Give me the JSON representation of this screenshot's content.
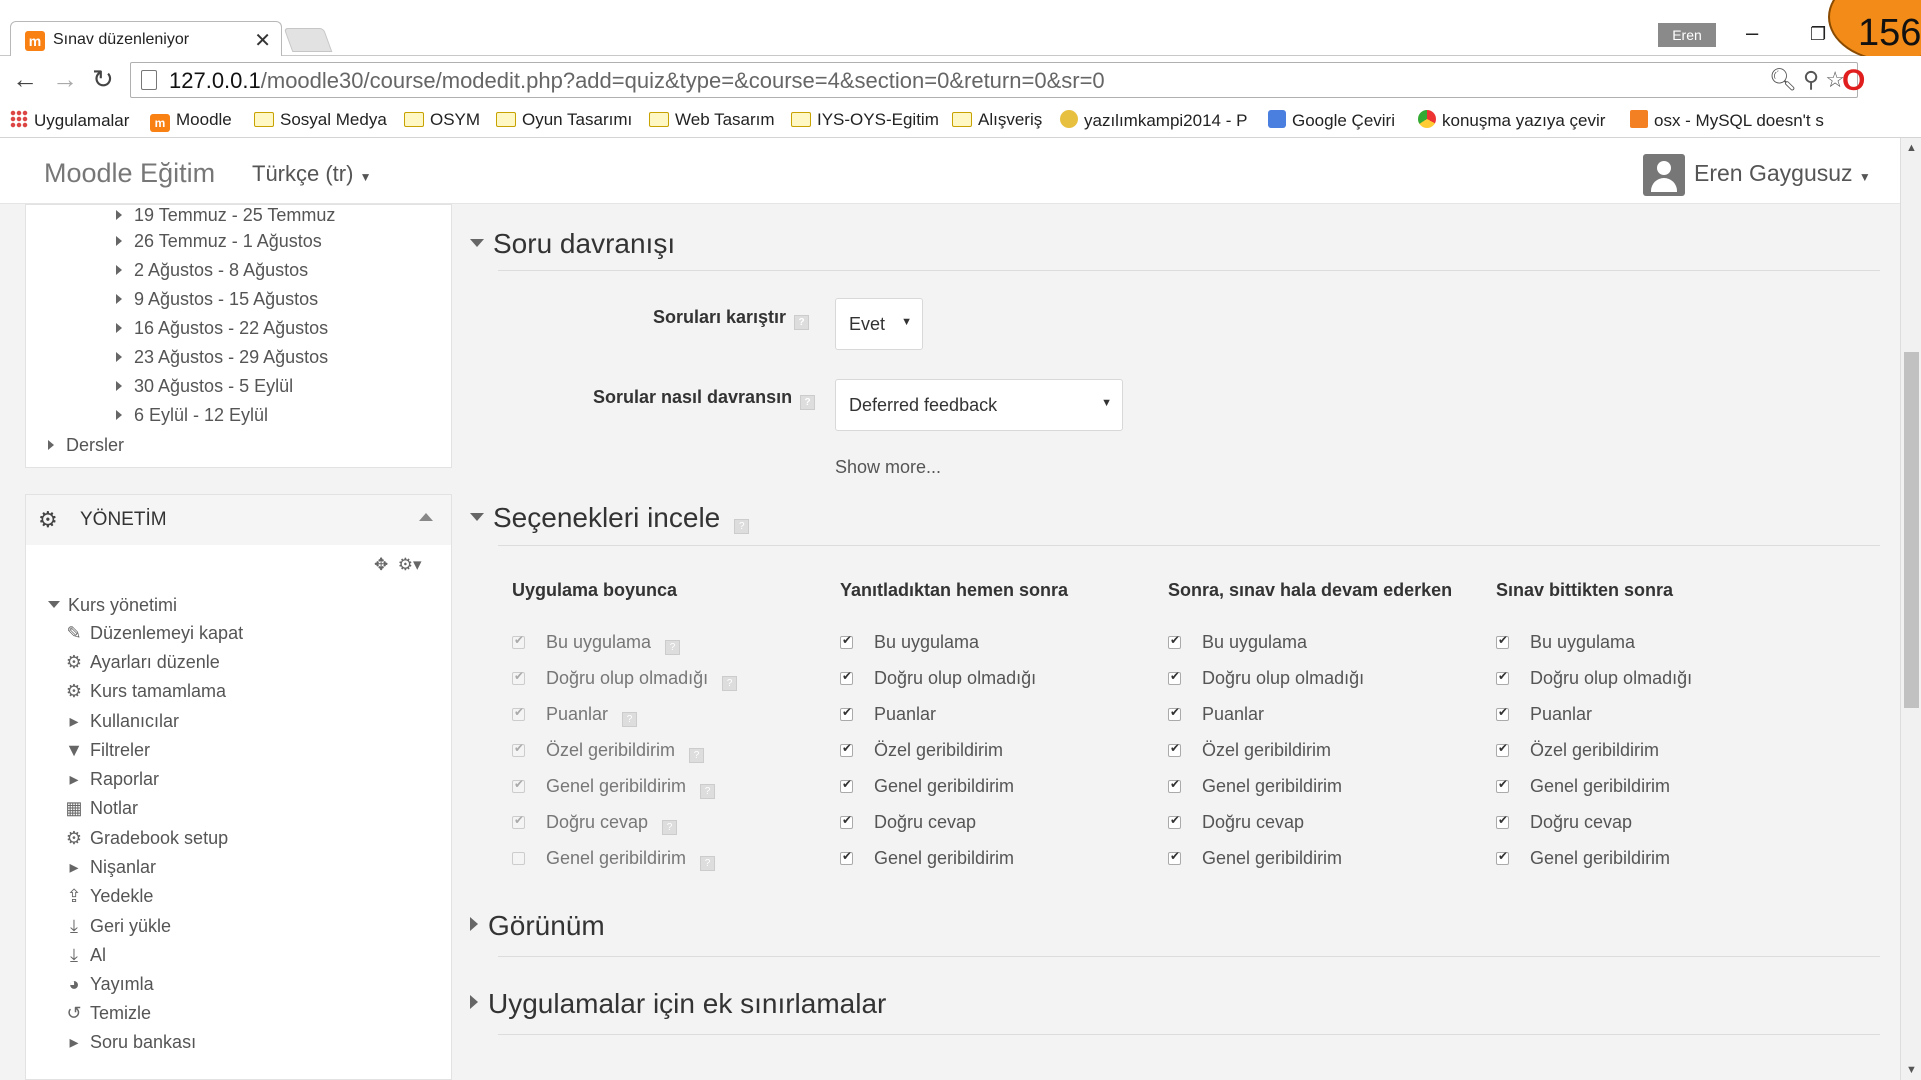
{
  "browser": {
    "tab_title": "Sınav düzenleniyor",
    "tab_close": "✕",
    "user_badge": "Eren",
    "slide_number": "156",
    "url_host": "127.0.0.1",
    "url_path": "/moodle30/course/modedit.php?add=quiz&type=&course=4&section=0&return=0&sr=0",
    "bookmarks": [
      {
        "label": "Uygulamalar",
        "icon": "apps-grid-icon"
      },
      {
        "label": "Moodle",
        "icon": "moodle-icon"
      },
      {
        "label": "Sosyal Medya",
        "icon": "folder-icon"
      },
      {
        "label": "OSYM",
        "icon": "folder-icon"
      },
      {
        "label": "Oyun Tasarımı",
        "icon": "folder-icon"
      },
      {
        "label": "Web Tasarım",
        "icon": "folder-icon"
      },
      {
        "label": "IYS-OYS-Egitim",
        "icon": "folder-icon"
      },
      {
        "label": "Alışveriş",
        "icon": "folder-icon"
      },
      {
        "label": "yazılımkampi2014 - P",
        "icon": "site-icon"
      },
      {
        "label": "Google Çeviri",
        "icon": "translate-icon"
      },
      {
        "label": "konuşma yazıya çevir",
        "icon": "chrome-icon"
      },
      {
        "label": "osx - MySQL doesn't s",
        "icon": "stackoverflow-icon"
      }
    ]
  },
  "moodle": {
    "brand": "Moodle Eğitim",
    "language": "Türkçe (tr)",
    "user_name": "Eren Gaygusuz"
  },
  "navigation": {
    "weeks": [
      "19 Temmuz - 25 Temmuz",
      "26 Temmuz - 1 Ağustos",
      "2 Ağustos - 8 Ağustos",
      "9 Ağustos - 15 Ağustos",
      "16 Ağustos - 22 Ağustos",
      "23 Ağustos - 29 Ağustos",
      "30 Ağustos - 5 Eylül",
      "6 Eylül - 12 Eylül"
    ],
    "courses_label": "Dersler"
  },
  "admin": {
    "title": "YÖNETİM",
    "course_admin": "Kurs yönetimi",
    "items": [
      {
        "label": "Düzenlemeyi kapat",
        "icon": "pencil-icon"
      },
      {
        "label": "Ayarları düzenle",
        "icon": "gear-icon"
      },
      {
        "label": "Kurs tamamlama",
        "icon": "gear-icon"
      },
      {
        "label": "Kullanıcılar",
        "icon": "chevron-right-icon"
      },
      {
        "label": "Filtreler",
        "icon": "filter-icon"
      },
      {
        "label": "Raporlar",
        "icon": "chevron-right-icon"
      },
      {
        "label": "Notlar",
        "icon": "table-icon"
      },
      {
        "label": "Gradebook setup",
        "icon": "gear-icon"
      },
      {
        "label": "Nişanlar",
        "icon": "chevron-right-icon"
      },
      {
        "label": "Yedekle",
        "icon": "upload-icon"
      },
      {
        "label": "Geri yükle",
        "icon": "download-icon"
      },
      {
        "label": "Al",
        "icon": "download-icon"
      },
      {
        "label": "Yayımla",
        "icon": "globe-icon"
      },
      {
        "label": "Temizle",
        "icon": "reset-icon"
      },
      {
        "label": "Soru bankası",
        "icon": "chevron-right-icon"
      }
    ]
  },
  "form": {
    "behaviour_section": "Soru davranışı",
    "shuffle_label": "Soruları karıştır",
    "shuffle_value": "Evet",
    "behaviour_label": "Sorular nasıl davransın",
    "behaviour_value": "Deferred feedback",
    "show_more": "Show more...",
    "review_section": "Seçenekleri incele",
    "review_columns": [
      {
        "header": "Uygulama boyunca",
        "disabled": true,
        "options": [
          {
            "label": "Bu uygulama",
            "checked": true,
            "help": true
          },
          {
            "label": "Doğru olup olmadığı",
            "checked": true,
            "help": true
          },
          {
            "label": "Puanlar",
            "checked": true,
            "help": true
          },
          {
            "label": "Özel geribildirim",
            "checked": true,
            "help": true
          },
          {
            "label": "Genel geribildirim",
            "checked": true,
            "help": true
          },
          {
            "label": "Doğru cevap",
            "checked": true,
            "help": true
          },
          {
            "label": "Genel geribildirim",
            "checked": false,
            "help": true
          }
        ]
      },
      {
        "header": "Yanıtladıktan hemen sonra",
        "disabled": false,
        "options": [
          {
            "label": "Bu uygulama",
            "checked": true
          },
          {
            "label": "Doğru olup olmadığı",
            "checked": true
          },
          {
            "label": "Puanlar",
            "checked": true
          },
          {
            "label": "Özel geribildirim",
            "checked": true
          },
          {
            "label": "Genel geribildirim",
            "checked": true
          },
          {
            "label": "Doğru cevap",
            "checked": true
          },
          {
            "label": "Genel geribildirim",
            "checked": true
          }
        ]
      },
      {
        "header": "Sonra, sınav hala devam ederken",
        "disabled": false,
        "options": [
          {
            "label": "Bu uygulama",
            "checked": true
          },
          {
            "label": "Doğru olup olmadığı",
            "checked": true
          },
          {
            "label": "Puanlar",
            "checked": true
          },
          {
            "label": "Özel geribildirim",
            "checked": true
          },
          {
            "label": "Genel geribildirim",
            "checked": true
          },
          {
            "label": "Doğru cevap",
            "checked": true
          },
          {
            "label": "Genel geribildirim",
            "checked": true
          }
        ]
      },
      {
        "header": "Sınav bittikten sonra",
        "disabled": false,
        "options": [
          {
            "label": "Bu uygulama",
            "checked": true
          },
          {
            "label": "Doğru olup olmadığı",
            "checked": true
          },
          {
            "label": "Puanlar",
            "checked": true
          },
          {
            "label": "Özel geribildirim",
            "checked": true
          },
          {
            "label": "Genel geribildirim",
            "checked": true
          },
          {
            "label": "Doğru cevap",
            "checked": true
          },
          {
            "label": "Genel geribildirim",
            "checked": true
          }
        ]
      }
    ],
    "appearance_section": "Görünüm",
    "restrictions_section": "Uygulamalar için ek sınırlamalar"
  },
  "colors": {
    "moodle_orange": "#f98012",
    "slide_badge": "#f28b17",
    "content_bg": "#f3f3f3"
  }
}
